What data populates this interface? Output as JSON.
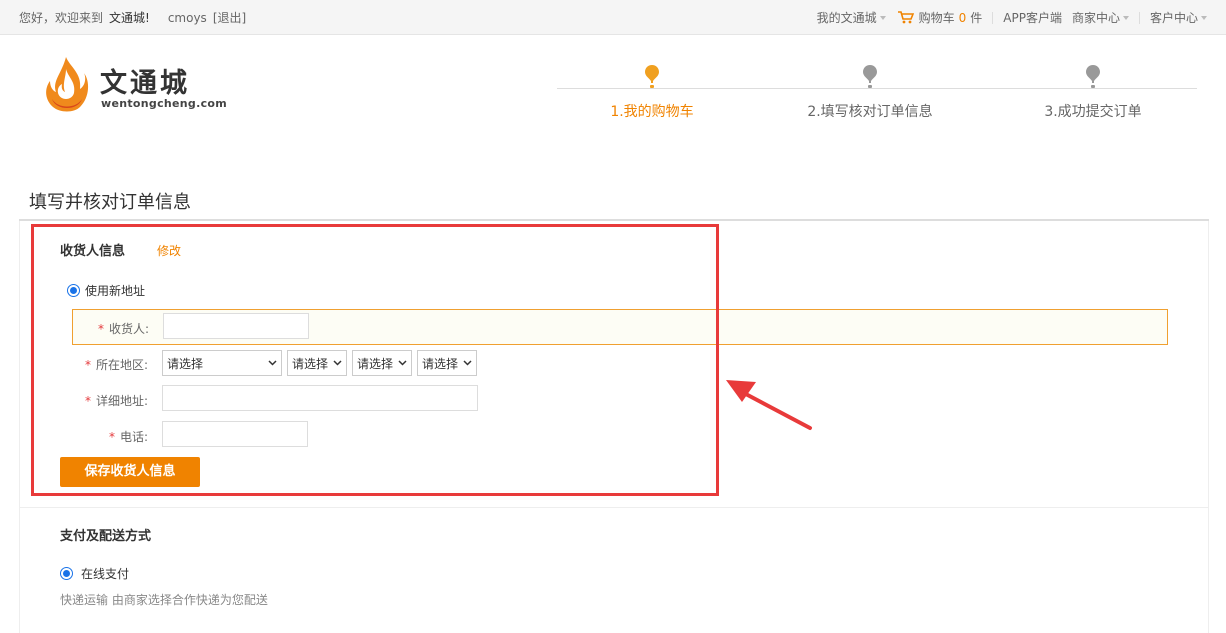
{
  "topbar": {
    "greeting": "您好，欢迎来到",
    "brand": "文通城!",
    "username": "cmoys",
    "logout": "[退出]",
    "my_account": "我的文通城",
    "cart_label": "购物车",
    "cart_count": "0",
    "cart_unit": "件",
    "app": "APP客户端",
    "merchant": "商家中心",
    "customer": "客户中心"
  },
  "logo": {
    "cn": "文通城",
    "en": "wentongcheng.com"
  },
  "steps": [
    {
      "label": "1.我的购物车",
      "active": true
    },
    {
      "label": "2.填写核对订单信息",
      "active": false
    },
    {
      "label": "3.成功提交订单",
      "active": false
    }
  ],
  "page_title": "填写并核对订单信息",
  "consignee": {
    "heading": "收货人信息",
    "edit": "修改",
    "use_new": "使用新地址",
    "fields": {
      "name_label": "收货人:",
      "name_value": "",
      "region_label": "所在地区:",
      "region_selects": [
        "请选择",
        "请选择",
        "请选择",
        "请选择"
      ],
      "address_label": "详细地址:",
      "address_value": "",
      "phone_label": "电话:",
      "phone_value": ""
    },
    "save_button": "保存收货人信息"
  },
  "payment": {
    "heading": "支付及配送方式",
    "option": "在线支付",
    "shipping_note": "快递运输 由商家选择合作快递为您配送"
  },
  "colors": {
    "accent": "#f08300",
    "required": "#e4393c",
    "annotation": "#e83a3a",
    "radio": "#1a73e8"
  }
}
